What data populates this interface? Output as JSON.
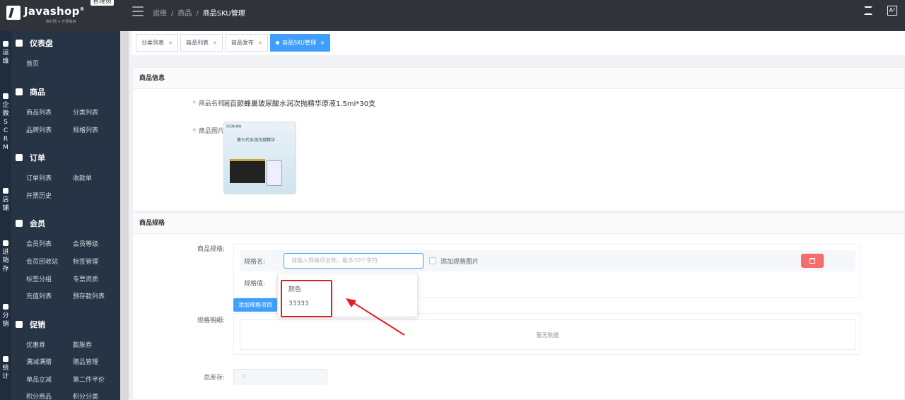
{
  "topbar": {
    "logo_name": "Javashop",
    "logo_reg": "®",
    "logo_tagline": "拼打网 ✦ 开源易用",
    "admin_badge": "管理员",
    "breadcrumb": [
      "运维",
      "商品",
      "商品SKU管理"
    ],
    "font_icon_label": "A²"
  },
  "rail": [
    {
      "label": "运维",
      "icon": "dashboard-icon"
    },
    {
      "label": "企微SCRM",
      "icon": "wechat-work-icon"
    },
    {
      "label": "店铺",
      "icon": "shop-icon"
    },
    {
      "label": "进销存",
      "icon": "inventory-icon"
    },
    {
      "label": "分销",
      "icon": "distribution-icon"
    },
    {
      "label": "统计",
      "icon": "statistics-icon"
    }
  ],
  "sidebar": {
    "dashboard": {
      "title": "仪表盘",
      "items": [
        "首页"
      ]
    },
    "goods": {
      "title": "商品",
      "items": [
        "商品列表",
        "分类列表",
        "品牌列表",
        "规格列表"
      ]
    },
    "orders": {
      "title": "订单",
      "items": [
        "订单列表",
        "收款单",
        "开票历史"
      ]
    },
    "members": {
      "title": "会员",
      "items": [
        "会员列表",
        "会员等级",
        "会员回收站",
        "标签管理",
        "标签分组",
        "专票资质",
        "充值列表",
        "预存款列表"
      ]
    },
    "promotion": {
      "title": "促销",
      "items": [
        "优惠券",
        "膨胀券",
        "满减满赠",
        "赠品管理",
        "单品立减",
        "第二件半价",
        "积分商品",
        "积分分类"
      ]
    }
  },
  "tabs": [
    {
      "label": "分类列表",
      "active": false
    },
    {
      "label": "商品列表",
      "active": false
    },
    {
      "label": "商品发布",
      "active": false
    },
    {
      "label": "商品SKU管理",
      "active": true
    }
  ],
  "info_card": {
    "title": "商品信息",
    "name_label": "商品名称:",
    "name_value": "润百颜蜂巢玻尿酸水润次抛精华原液1.5ml*30支",
    "image_label": "商品图片:",
    "image_brand_text": "润百颜 蜂巢",
    "image_banner_text": "第三代水润次抛精华"
  },
  "spec_card": {
    "title": "商品规格",
    "spec_label": "商品规格:",
    "spec_name_label": "规格名:",
    "spec_name_placeholder": "请输入规格项名称，最多30个字符",
    "add_spec_image_label": "添加规格图片",
    "spec_value_label": "规格值:",
    "add_spec_item_button": "添加规格项目",
    "detail_label": "规格明细:",
    "detail_empty": "暂无数据",
    "stock_label": "总库存:",
    "stock_value": "0"
  },
  "dropdown": {
    "options": [
      "颜色",
      "33333"
    ]
  },
  "colors": {
    "primary": "#409eff",
    "danger": "#f56c6c",
    "annotation": "#e02020",
    "topbar": "#30333a",
    "sidebar": "#263445"
  }
}
